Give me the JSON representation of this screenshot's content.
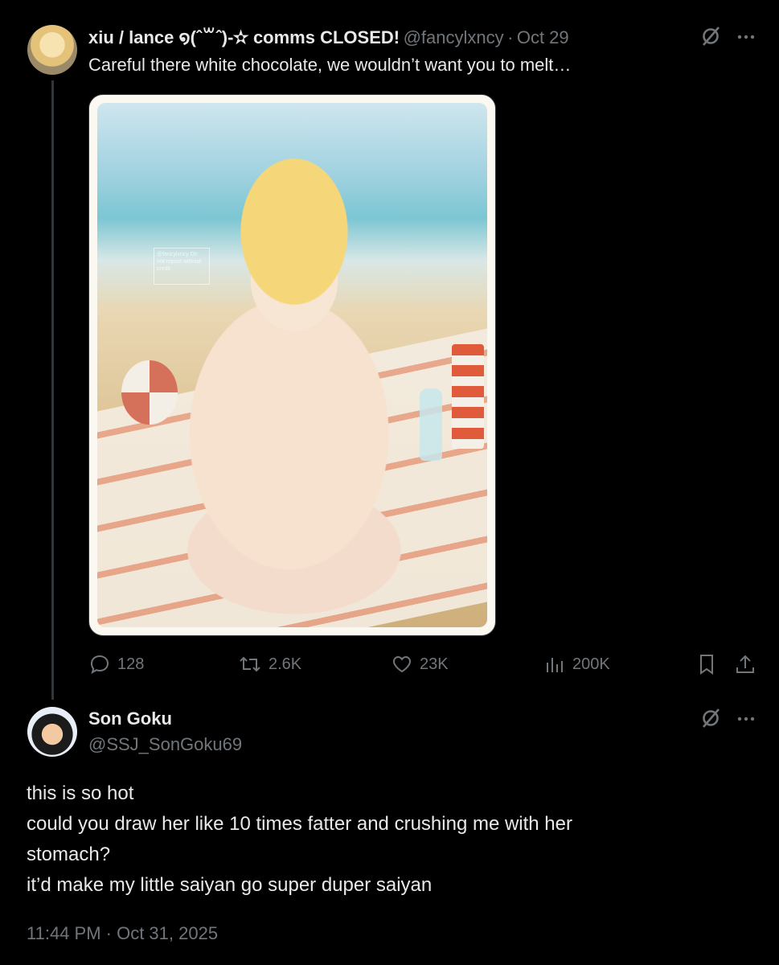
{
  "tweet1": {
    "display_name": "xiu / lance ໑(ˆ꒳ˆ)-✫ comms CLOSED!",
    "handle": "@fancylxncy",
    "separator": "·",
    "date": "Oct 29",
    "text": "Careful there white chocolate, we wouldn’t want you to melt…",
    "watermark": "@fancylxncy Do not repost without credit",
    "stats": {
      "replies": "128",
      "reposts": "2.6K",
      "likes": "23K",
      "views": "200K"
    }
  },
  "tweet2": {
    "display_name": "Son Goku",
    "handle": "@SSJ_SonGoku69",
    "lines": [
      "this is so hot",
      "could you draw her like 10 times fatter and crushing me with her",
      "stomach?",
      "it’d make my little saiyan go super duper saiyan"
    ],
    "timestamp": "11:44 PM · Oct 31, 2025"
  },
  "icons": {
    "grok": "grok-icon",
    "more": "more-icon",
    "reply": "reply-icon",
    "repost": "repost-icon",
    "like": "heart-icon",
    "views": "views-icon",
    "bookmark": "bookmark-icon",
    "share": "share-icon"
  }
}
